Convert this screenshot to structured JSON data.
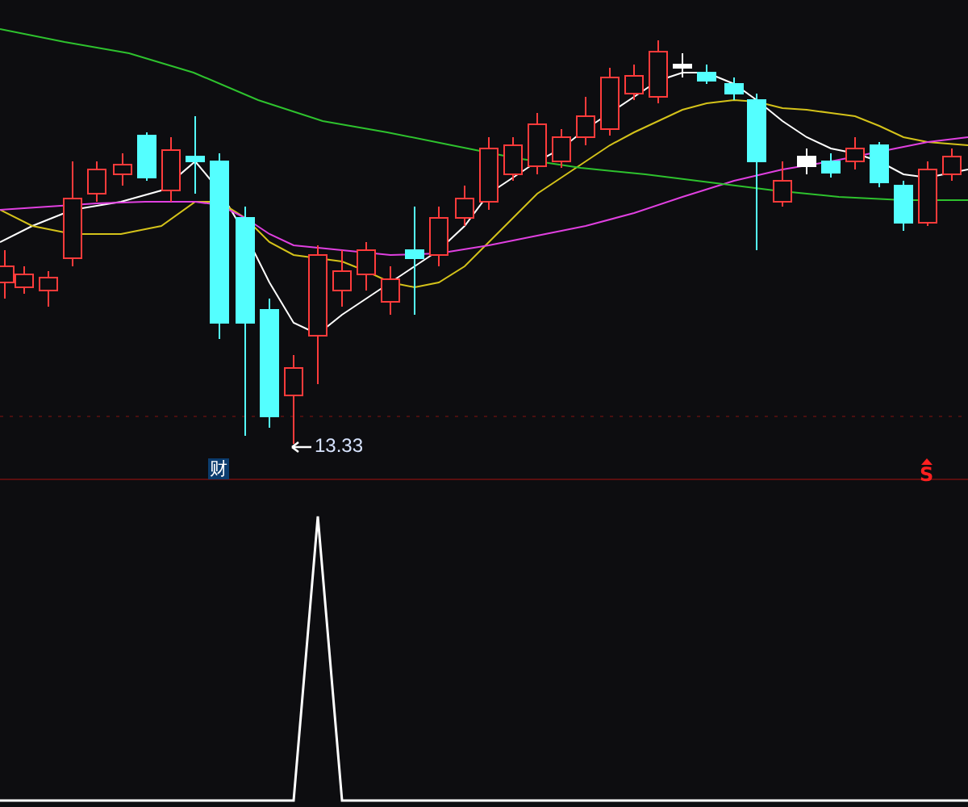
{
  "chart": {
    "low_price_label": "13.33",
    "finance_marker": "财",
    "signal_marker": "S"
  }
}
